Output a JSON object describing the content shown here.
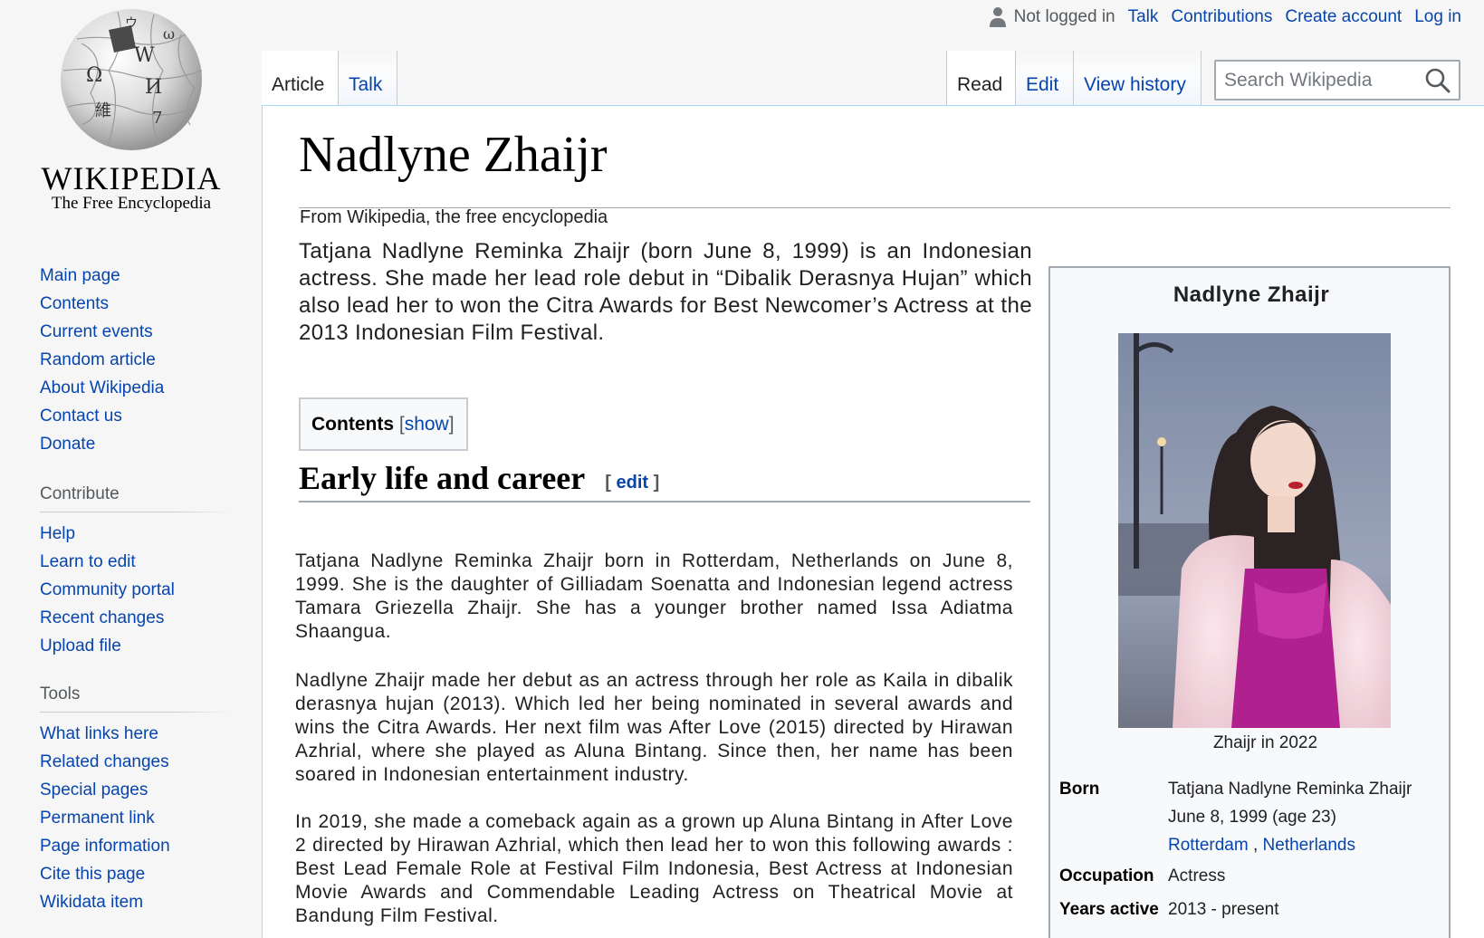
{
  "logo": {
    "wordmark": "WIKIPEDIA",
    "tagline": "The Free Encyclopedia",
    "globe_glyphs": [
      "Ω",
      "W",
      "И",
      "維",
      "ウ",
      "ω",
      "7"
    ]
  },
  "sidebar": {
    "navigation": [
      {
        "label": "Main page"
      },
      {
        "label": "Contents"
      },
      {
        "label": "Current events"
      },
      {
        "label": "Random article"
      },
      {
        "label": "About Wikipedia"
      },
      {
        "label": "Contact us"
      },
      {
        "label": "Donate"
      }
    ],
    "contribute_heading": "Contribute",
    "contribute": [
      {
        "label": "Help"
      },
      {
        "label": "Learn to edit"
      },
      {
        "label": "Community portal"
      },
      {
        "label": "Recent changes"
      },
      {
        "label": "Upload file"
      }
    ],
    "tools_heading": "Tools",
    "tools": [
      {
        "label": "What links here"
      },
      {
        "label": "Related changes"
      },
      {
        "label": "Special pages"
      },
      {
        "label": "Permanent link"
      },
      {
        "label": "Page information"
      },
      {
        "label": "Cite this page"
      },
      {
        "label": "Wikidata item"
      }
    ]
  },
  "personal": {
    "not_logged_in": "Not logged in",
    "talk": "Talk",
    "contributions": "Contributions",
    "create_account": "Create account",
    "log_in": "Log in"
  },
  "tabs": {
    "article": "Article",
    "talk": "Talk",
    "read": "Read",
    "edit": "Edit",
    "view_history": "View history"
  },
  "search": {
    "placeholder": "Search Wikipedia"
  },
  "article": {
    "title": "Nadlyne Zhaijr",
    "site_sub": "From Wikipedia, the free encyclopedia",
    "lead": "Tatjana Nadlyne Reminka Zhaijr (born June 8, 1999) is an Indonesian actress. She made her lead role debut in “Dibalik Derasnya Hujan” which also lead her to won the Citra Awards for Best Newcomer’s Actress at the 2013 Indonesian Film Festival.",
    "toc": {
      "label": "Contents",
      "open_bracket": "[",
      "show": "show",
      "close_bracket": "]"
    },
    "section_heading": "Early life and career",
    "section_edit": {
      "open_bracket": "[",
      "label": "edit",
      "close_bracket": "]"
    },
    "paragraphs": [
      "Tatjana Nadlyne Reminka Zhaijr born in Rotterdam, Netherlands on June 8, 1999. She is the daughter of Gilliadam Soenatta and Indonesian legend actress Tamara Griezella Zhaijr. She has a younger brother named Issa Adiatma Shaangua.",
      "Nadlyne Zhaijr made her debut as an actress through her role as Kaila in dibalik derasnya hujan (2013). Which led her being nominated in several awards and wins the Citra Awards. Her next film was After Love (2015) directed by Hirawan Azhrial, where she played as Aluna Bintang. Since then, her name has been soared in Indonesian entertainment industry.",
      "In 2019, she made a comeback again as a grown up Aluna Bintang in After Love 2 directed by Hirawan Azhrial, which then lead her to won this following awards : Best Lead Female Role at Festival Film Indonesia, Best Actress at  Indonesian Movie Awards and Commendable Leading Actress on Theatrical Movie at Bandung Film Festival."
    ]
  },
  "infobox": {
    "title": "Nadlyne Zhaijr",
    "caption": "Zhaijr in 2022",
    "born_label": "Born",
    "born_name": "Tatjana Nadlyne Reminka Zhaijr",
    "born_date": "June 8, 1999 (age 23)",
    "born_city": "Rotterdam",
    "born_sep": ",",
    "born_country": "Netherlands",
    "occupation_label": "Occupation",
    "occupation": "Actress",
    "years_label": "Years active",
    "years": "2013 - present"
  },
  "colors": {
    "link": "#0645ad",
    "text": "#202122",
    "sidebar_bg": "#f6f6f6",
    "border": "#a2a9b1",
    "tab_border": "#a7d7f9"
  }
}
